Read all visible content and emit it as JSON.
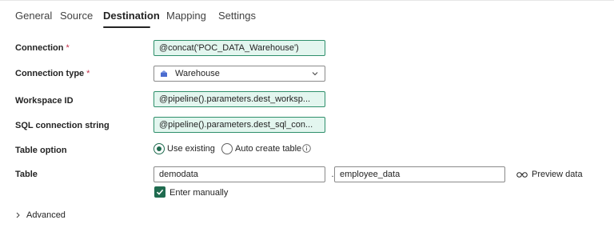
{
  "tabs": [
    {
      "label": "General"
    },
    {
      "label": "Source"
    },
    {
      "label": "Destination",
      "active": true
    },
    {
      "label": "Mapping"
    },
    {
      "label": "Settings"
    }
  ],
  "form": {
    "connection": {
      "label": "Connection",
      "required_mark": "*",
      "value": "@concat('POC_DATA_Warehouse')"
    },
    "connection_type": {
      "label": "Connection type",
      "required_mark": "*",
      "value": "Warehouse",
      "icon": "warehouse-icon"
    },
    "workspace_id": {
      "label": "Workspace ID",
      "value": "@pipeline().parameters.dest_worksp..."
    },
    "sql_connection_string": {
      "label": "SQL connection string",
      "value": "@pipeline().parameters.dest_sql_con..."
    },
    "table_option": {
      "label": "Table option",
      "options": [
        {
          "label": "Use existing",
          "selected": true
        },
        {
          "label": "Auto create table",
          "selected": false
        }
      ]
    },
    "table": {
      "label": "Table",
      "schema_value": "demodata",
      "separator": ".",
      "table_value": "employee_data",
      "preview_label": "Preview data",
      "enter_manually": {
        "label": "Enter manually",
        "checked": true
      }
    },
    "advanced": {
      "label": "Advanced"
    }
  },
  "colors": {
    "accent": "#1f6b4f",
    "dynamic_field_bg": "#e3f6ef",
    "required": "#c4314b"
  }
}
